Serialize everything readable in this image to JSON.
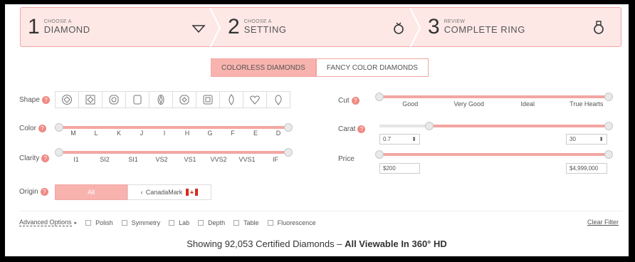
{
  "steps": [
    {
      "num": "1",
      "small": "CHOOSE A",
      "big": "DIAMOND",
      "icon": "diamond-icon"
    },
    {
      "num": "2",
      "small": "CHOOSE A",
      "big": "SETTING",
      "icon": "ring-icon"
    },
    {
      "num": "3",
      "small": "REVIEW",
      "big": "COMPLETE RING",
      "icon": "ring-with-diamond-icon"
    }
  ],
  "tabs": {
    "colorless": "COLORLESS DIAMONDS",
    "fancy": "FANCY COLOR DIAMONDS"
  },
  "filters": {
    "shape_label": "Shape",
    "color_label": "Color",
    "clarity_label": "Clarity",
    "origin_label": "Origin",
    "cut_label": "Cut",
    "carat_label": "Carat",
    "price_label": "Price",
    "help_glyph": "?"
  },
  "color_ticks": [
    "M",
    "L",
    "K",
    "J",
    "I",
    "H",
    "G",
    "F",
    "E",
    "D"
  ],
  "clarity_ticks": [
    "I1",
    "SI2",
    "SI1",
    "VS2",
    "VS1",
    "VVS2",
    "VVS1",
    "IF"
  ],
  "cut_ticks": [
    "Good",
    "Very Good",
    "Ideal",
    "True Hearts"
  ],
  "carat": {
    "min": "0.7",
    "max": "30"
  },
  "price": {
    "min": "$200",
    "max": "$4,999,000"
  },
  "origin": {
    "all": "All",
    "canadamark": "CanadaMark"
  },
  "advanced": {
    "label": "Advanced Options",
    "options": [
      "Polish",
      "Symmetry",
      "Lab",
      "Depth",
      "Table",
      "Fluorescence"
    ],
    "clear": "Clear Filter"
  },
  "summary": {
    "prefix": "Showing 92,053 Certified Diamonds – ",
    "bold": "All Viewable In 360° HD"
  },
  "colors": {
    "accent": "#f3a6a2",
    "accent_fill": "#f8b3ae",
    "steps_bg": "#fde8e6"
  }
}
